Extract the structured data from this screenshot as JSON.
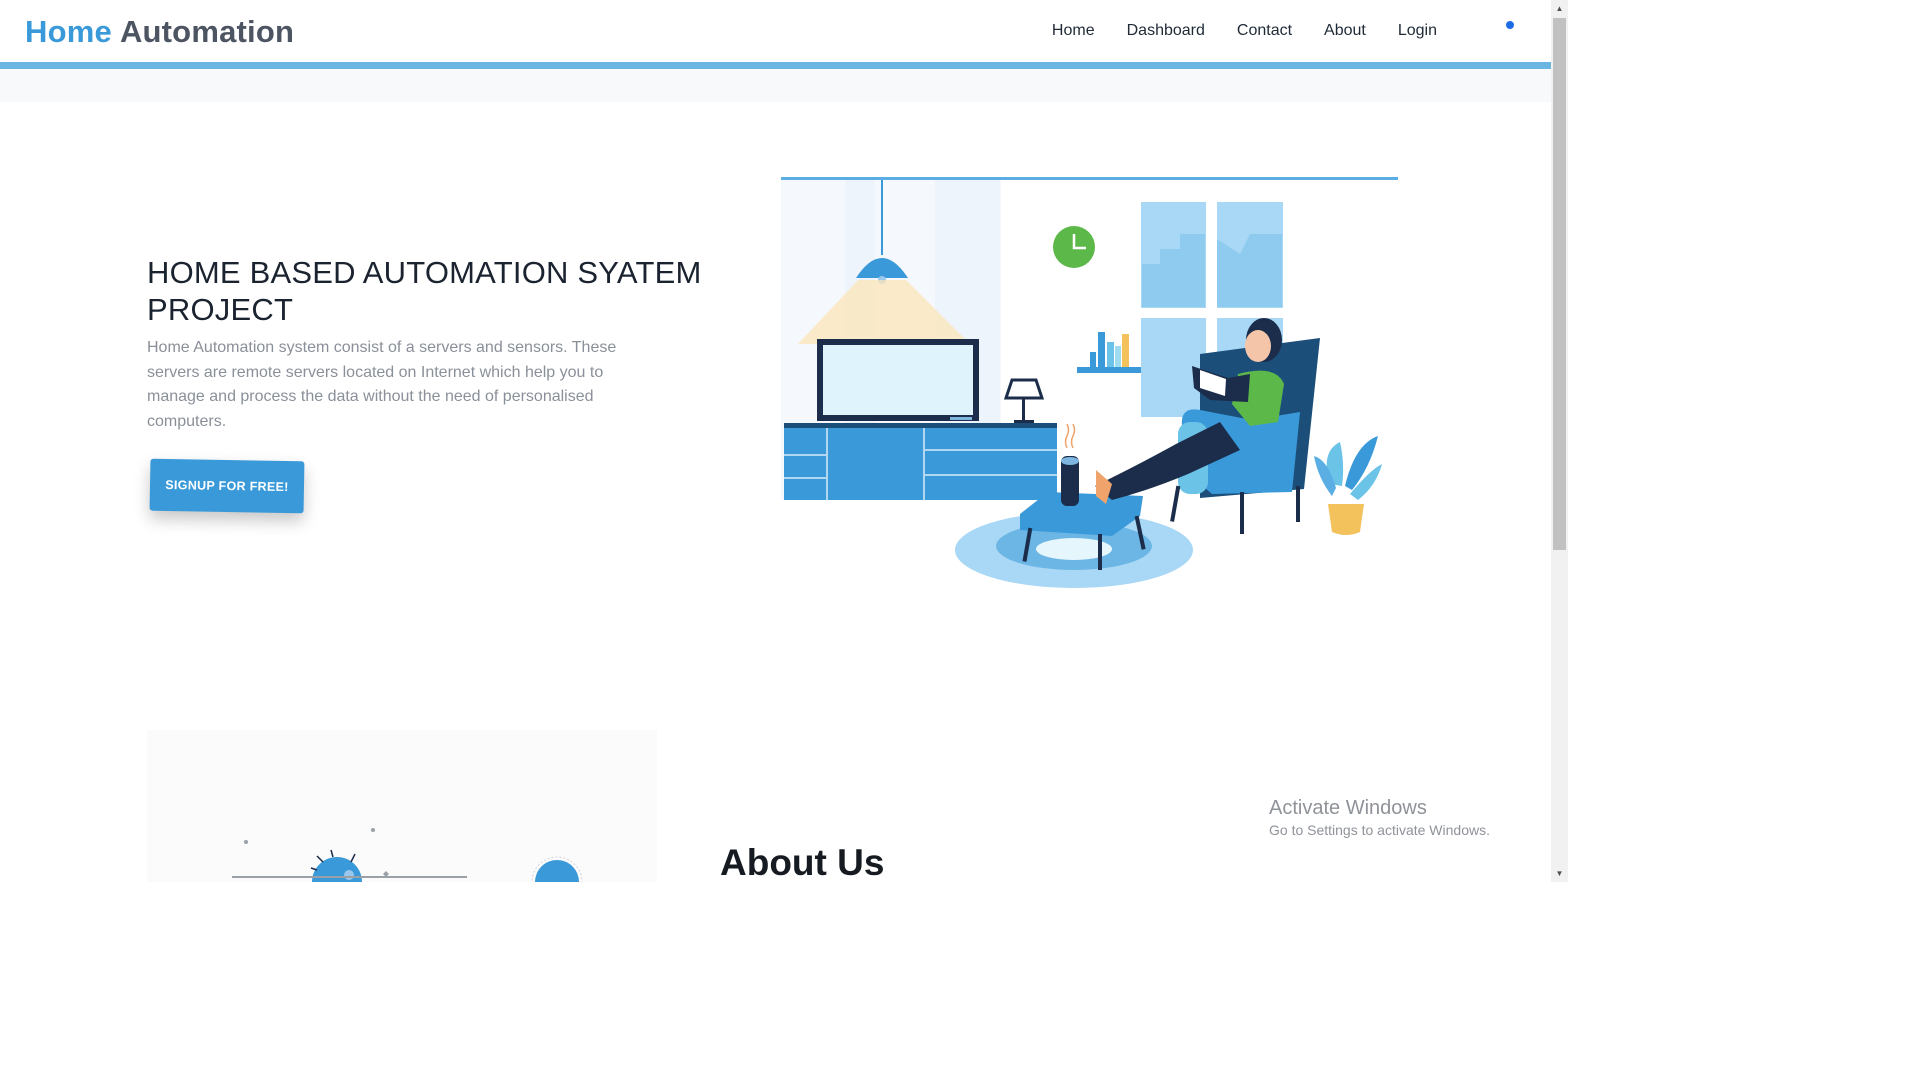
{
  "header": {
    "brand_part1": "Home",
    "brand_part2": "Automation",
    "nav": [
      "Home",
      "Dashboard",
      "Contact",
      "About",
      "Login"
    ]
  },
  "hero": {
    "title": "HOME BASED AUTOMATION SYATEM PROJECT",
    "description": "Home Automation system consist of a servers and sensors. These servers are remote servers located on Internet which help you to manage and process the data without the need of personalised computers.",
    "cta_label": "SIGNUP FOR FREE!"
  },
  "about": {
    "title": "About Us"
  },
  "watermark": {
    "title": "Activate Windows",
    "subtitle": "Go to Settings to activate Windows."
  },
  "colors": {
    "brand_blue": "#3a9ad9",
    "brand_gray": "#4d5563",
    "header_rule": "#6bb5e2",
    "nav_dot": "#1e6be6"
  },
  "icons": {
    "scroll_up": "scroll-up-arrow-icon",
    "scroll_down": "scroll-down-arrow-icon"
  }
}
